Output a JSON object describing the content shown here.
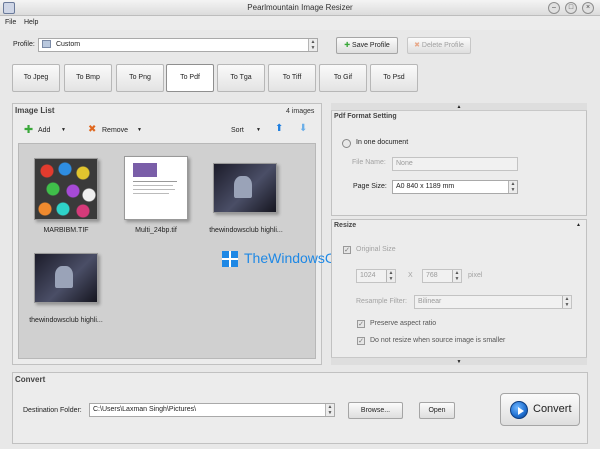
{
  "window": {
    "title": "Pearlmountain Image Resizer"
  },
  "menu": {
    "file": "File",
    "help": "Help"
  },
  "profile": {
    "label": "Profile:",
    "value": "Custom",
    "save": "Save Profile",
    "delete": "Delete Profile"
  },
  "tabs": [
    "To Jpeg",
    "To Bmp",
    "To Png",
    "To Pdf",
    "To Tga",
    "To Tiff",
    "To Gif",
    "To Psd"
  ],
  "image_list": {
    "title": "Image List",
    "count": "4 images",
    "add": "Add",
    "remove": "Remove",
    "sort": "Sort",
    "items": [
      "MARBIBM.TIF",
      "Multi_24bp.tif",
      "thewindowsclub highli...",
      "thewindowsclub highli..."
    ]
  },
  "pdf": {
    "title": "Pdf Format Setting",
    "one_document": "In one document",
    "file_name_label": "File Name:",
    "file_name_placeholder": "None",
    "page_size_label": "Page Size:",
    "page_size_value": "A0 840 x 1189 mm"
  },
  "resize": {
    "title": "Resize",
    "original_size": "Original Size",
    "width": "1024",
    "x": "X",
    "height": "768",
    "unit": "pixel",
    "resample_label": "Resample Filter:",
    "resample_value": "Bilinear",
    "preserve": "Preserve aspect ratio",
    "no_resize": "Do not resize when source image is smaller"
  },
  "convert": {
    "title": "Convert",
    "dest_label": "Destination Folder:",
    "dest_value": "C:\\Users\\Laxman Singh\\Pictures\\",
    "browse": "Browse...",
    "open": "Open",
    "convert": "Convert"
  },
  "watermark": "TheWindowsClub",
  "colors": {
    "accent_blue": "#1f6fd0",
    "add_green": "#3aa83a",
    "remove_orange": "#e0671e",
    "watermark_blue": "#1e88e5"
  },
  "icons": [
    "app-icon",
    "folder-icon",
    "save-icon",
    "delete-icon",
    "add-icon",
    "remove-icon",
    "arrow-up-icon",
    "arrow-down-icon",
    "convert-icon",
    "windows-logo-icon"
  ]
}
